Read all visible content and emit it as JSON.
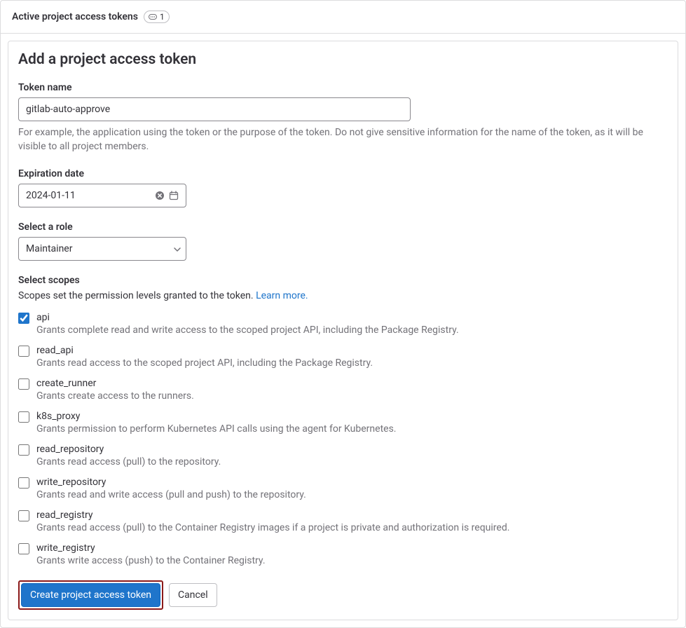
{
  "header": {
    "title": "Active project access tokens",
    "count": "1"
  },
  "form": {
    "title": "Add a project access token",
    "token_name": {
      "label": "Token name",
      "value": "gitlab-auto-approve",
      "help": "For example, the application using the token or the purpose of the token. Do not give sensitive information for the name of the token, as it will be visible to all project members."
    },
    "expiration": {
      "label": "Expiration date",
      "value": "2024-01-11"
    },
    "role": {
      "label": "Select a role",
      "value": "Maintainer"
    },
    "scopes": {
      "label": "Select scopes",
      "desc": "Scopes set the permission levels granted to the token. ",
      "learn_more": "Learn more.",
      "items": [
        {
          "name": "api",
          "desc": "Grants complete read and write access to the scoped project API, including the Package Registry.",
          "checked": true
        },
        {
          "name": "read_api",
          "desc": "Grants read access to the scoped project API, including the Package Registry.",
          "checked": false
        },
        {
          "name": "create_runner",
          "desc": "Grants create access to the runners.",
          "checked": false
        },
        {
          "name": "k8s_proxy",
          "desc": "Grants permission to perform Kubernetes API calls using the agent for Kubernetes.",
          "checked": false
        },
        {
          "name": "read_repository",
          "desc": "Grants read access (pull) to the repository.",
          "checked": false
        },
        {
          "name": "write_repository",
          "desc": "Grants read and write access (pull and push) to the repository.",
          "checked": false
        },
        {
          "name": "read_registry",
          "desc": "Grants read access (pull) to the Container Registry images if a project is private and authorization is required.",
          "checked": false
        },
        {
          "name": "write_registry",
          "desc": "Grants write access (push) to the Container Registry.",
          "checked": false
        }
      ]
    },
    "actions": {
      "create": "Create project access token",
      "cancel": "Cancel"
    }
  }
}
